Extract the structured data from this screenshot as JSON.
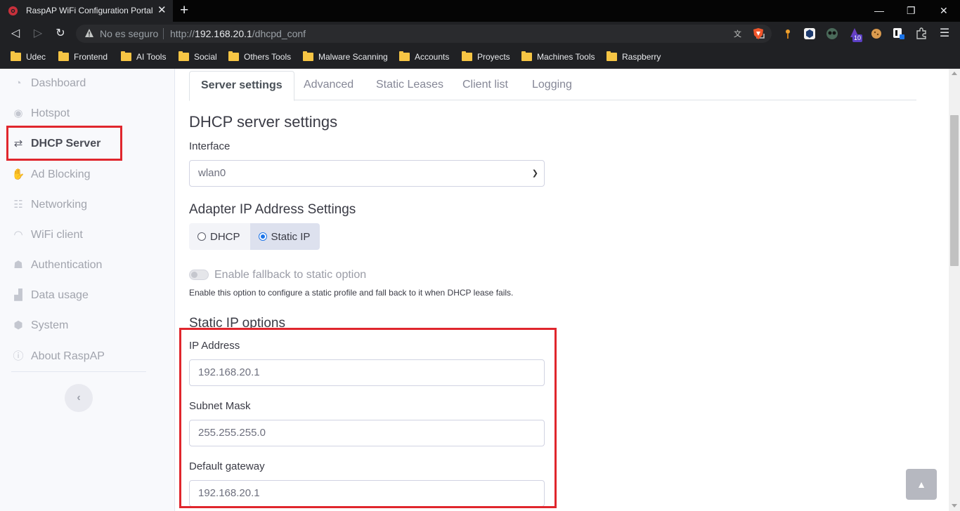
{
  "browser": {
    "tab_title": "RaspAP WiFi Configuration Portal",
    "tab_close": "✕",
    "new_tab": "+",
    "window_controls": {
      "minimize": "—",
      "restore": "❐",
      "close": "✕"
    },
    "security_label": "No es seguro",
    "url_scheme": "http://",
    "url_host": "192.168.20.1",
    "url_path": "/dhcpd_conf",
    "extension_badge": "10",
    "bookmarks": [
      "Udec",
      "Frontend",
      "AI Tools",
      "Social",
      "Others Tools",
      "Malware Scanning",
      "Accounts",
      "Proyects",
      "Machines Tools",
      "Raspberry"
    ]
  },
  "sidebar": {
    "items": [
      {
        "label": "Dashboard",
        "icon": "tachometer-icon"
      },
      {
        "label": "Hotspot",
        "icon": "dot-circle-icon"
      },
      {
        "label": "DHCP Server",
        "icon": "exchange-icon"
      },
      {
        "label": "Ad Blocking",
        "icon": "hand-paper-icon"
      },
      {
        "label": "Networking",
        "icon": "network-icon"
      },
      {
        "label": "WiFi client",
        "icon": "wifi-icon"
      },
      {
        "label": "Authentication",
        "icon": "user-lock-icon"
      },
      {
        "label": "Data usage",
        "icon": "chart-bar-icon"
      },
      {
        "label": "System",
        "icon": "cube-icon"
      },
      {
        "label": "About RaspAP",
        "icon": "info-circle-icon"
      }
    ],
    "active": "DHCP Server",
    "collapse_icon": "‹"
  },
  "tabs": [
    "Server settings",
    "Advanced",
    "Static Leases",
    "Client list",
    "Logging"
  ],
  "active_tab": "Server settings",
  "form": {
    "section_title": "DHCP server settings",
    "interface_label": "Interface",
    "interface_value": "wlan0",
    "adapter_title": "Adapter IP Address Settings",
    "mode_dhcp": "DHCP",
    "mode_static": "Static IP",
    "mode_selected": "Static IP",
    "fallback_label": "Enable fallback to static option",
    "fallback_enabled": false,
    "fallback_help": "Enable this option to configure a static profile and fall back to it when DHCP lease fails.",
    "static_title": "Static IP options",
    "ip_label": "IP Address",
    "ip_value": "192.168.20.1",
    "mask_label": "Subnet Mask",
    "mask_value": "255.255.255.0",
    "gateway_label": "Default gateway",
    "gateway_value": "192.168.20.1"
  },
  "colors": {
    "highlight": "#e0262d",
    "browser_bg": "#202124",
    "sidebar_bg": "#f8f9fc"
  }
}
